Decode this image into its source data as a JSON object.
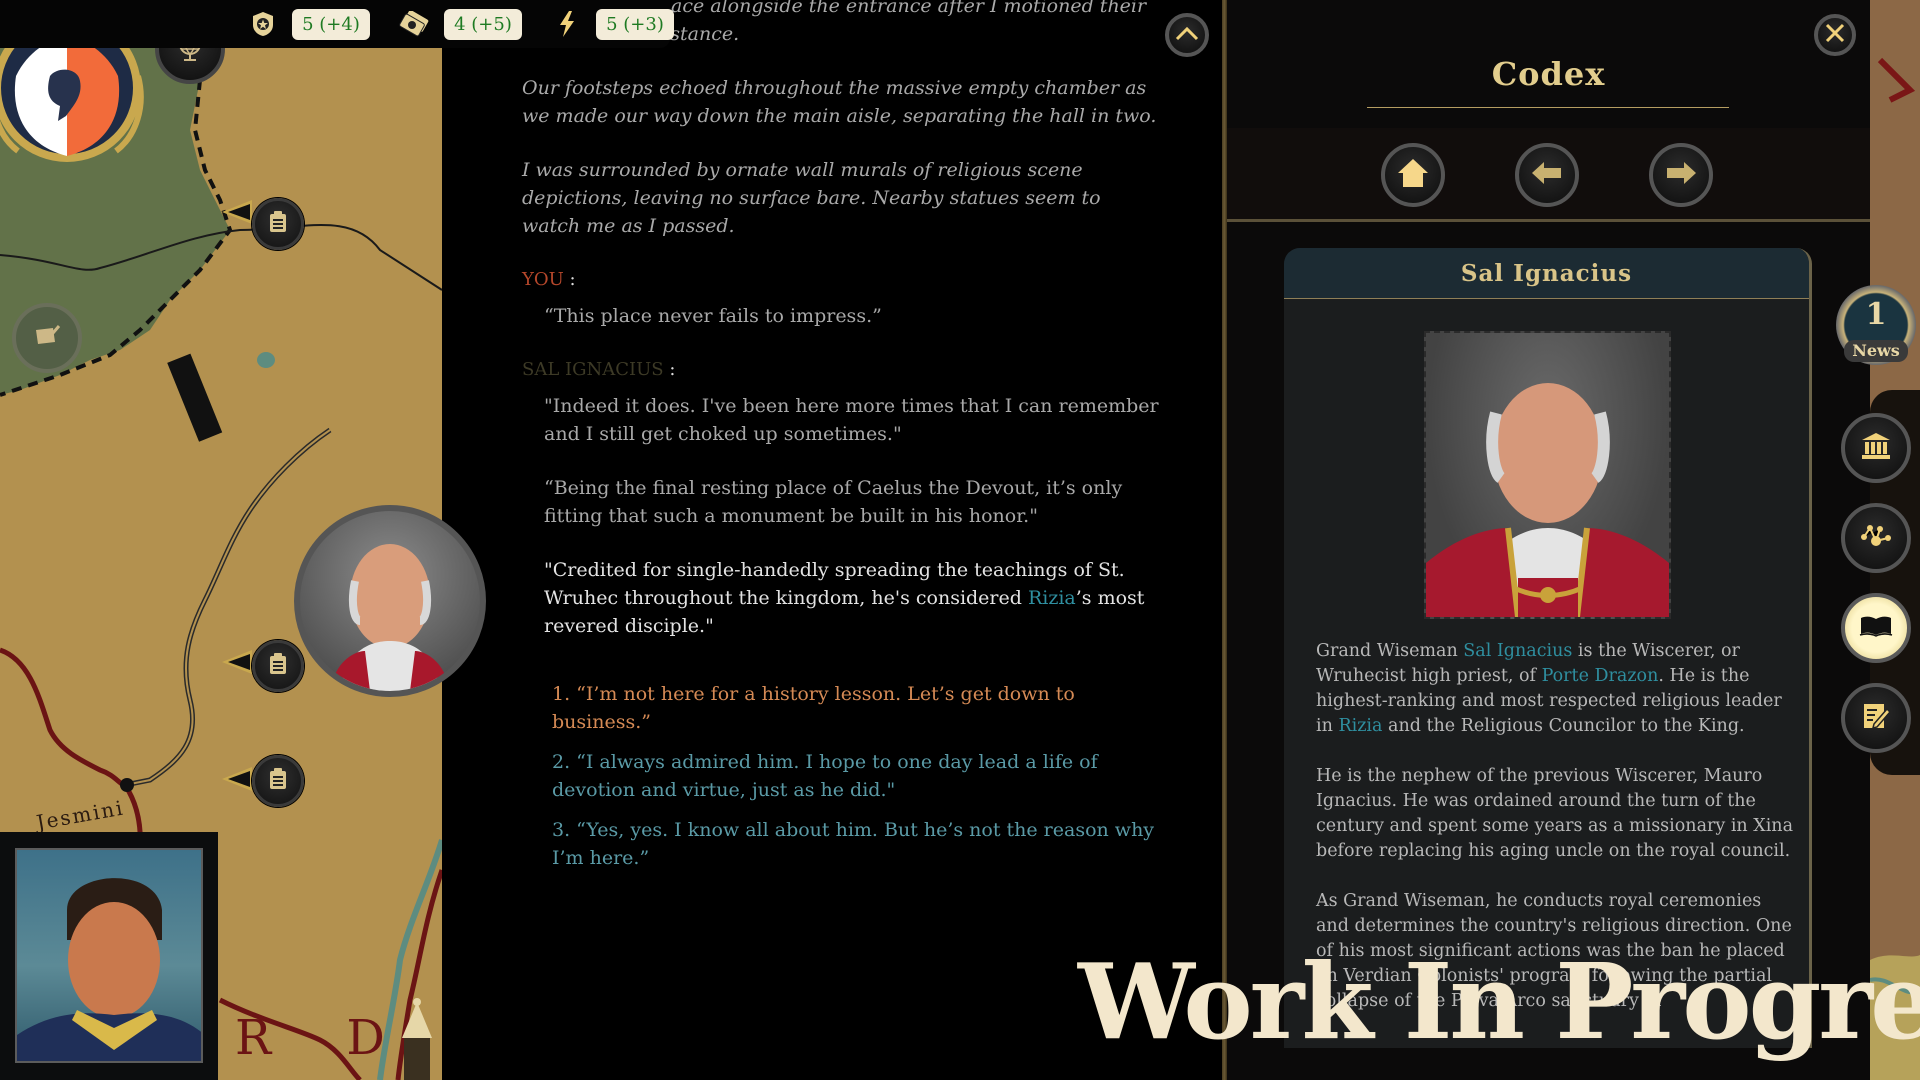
{
  "top_bar": {
    "stats": [
      {
        "icon": "badge-star-icon",
        "value": "5 (+4)"
      },
      {
        "icon": "money-icon",
        "value": "4 (+5)"
      },
      {
        "icon": "lightning-icon",
        "value": "5 (+3)"
      }
    ],
    "stat_value_color": "#1e7a22"
  },
  "map": {
    "labels": {
      "town": "Jesmini",
      "region_partial": "R D"
    },
    "buttons": {
      "globe": "globe-icon",
      "scroll": "scroll-quill-icon"
    }
  },
  "dialogue": {
    "narration": [
      "…ace alongside the entrance after I motioned their distance.",
      "Our footsteps echoed throughout the massive empty chamber as we made our way down the main aisle, separating the hall in two.",
      "I was surrounded by ornate wall murals of religious scene depictions, leaving no surface bare. Nearby statues seem to watch me as I passed."
    ],
    "player_speaker": "YOU",
    "player_line": "“This place never fails to impress.”",
    "npc_speaker": "SAL IGNACIUS",
    "npc_lines": [
      "\"Indeed it does. I've been here more times that I can remember and I still get choked up sometimes.\"",
      "“Being the final resting place of Caelus the Devout, it’s only fitting that such a monument be built in his honor.\""
    ],
    "npc_last_line": {
      "before": "\"Credited for single-handedly spreading the teachings of St. Wruhec throughout the kingdom, he's considered ",
      "link": "Rizia",
      "after": "’s most revered disciple.\""
    },
    "choices": [
      "1. “I’m not here for a history lesson. Let’s get down to business.”",
      "2. “I always admired him. I hope to one day lead a life of devotion and virtue, just as he did.\"",
      "3. “Yes, yes. I know all about him. But he’s not the reason why I’m here.”"
    ],
    "colors": {
      "player_speaker": "#b5472b",
      "npc_speaker": "#3d3a26",
      "choice_1": "#d58a55",
      "choice_other": "#5a9aa6",
      "link": "#2f8fa0"
    }
  },
  "codex": {
    "title": "Codex",
    "nav": {
      "home": "Home",
      "back": "Back",
      "forward": "Forward"
    },
    "entry": {
      "name": "Sal Ignacius",
      "paragraphs": [
        {
          "parts": [
            {
              "t": "Grand Wiseman "
            },
            {
              "t": "Sal Ignacius",
              "link": true
            },
            {
              "t": " is the Wiscerer, or Wruhecist high priest, of "
            },
            {
              "t": "Porte Drazon",
              "link": true
            },
            {
              "t": ". He is the highest-ranking and most respected religious leader in "
            },
            {
              "t": "Rizia",
              "link": true
            },
            {
              "t": " and the Religious Councilor to the King."
            }
          ]
        },
        {
          "parts": [
            {
              "t": "He is the nephew of the previous Wiscerer, Mauro Ignacius. He was ordained around the turn of the century and spent some years as a missionary in Xina before replacing his aging uncle on the royal council."
            }
          ]
        },
        {
          "parts": [
            {
              "t": "As Grand Wiseman, he conducts royal ceremonies and determines the country's religious direction. One of his most significant actions was the ban he placed on Verdian Colonists' program following the partial collapse of the Plava Arco sanctuary in"
            }
          ]
        }
      ]
    }
  },
  "sidebar": {
    "news": {
      "count": "1",
      "label": "News"
    },
    "buttons": [
      {
        "name": "government",
        "icon": "institution-icon",
        "active": false
      },
      {
        "name": "network",
        "icon": "network-nodes-icon",
        "active": false
      },
      {
        "name": "codex",
        "icon": "open-book-icon",
        "active": true
      },
      {
        "name": "journal",
        "icon": "notepad-pen-icon",
        "active": false
      }
    ]
  },
  "watermark": "Work In Progress"
}
